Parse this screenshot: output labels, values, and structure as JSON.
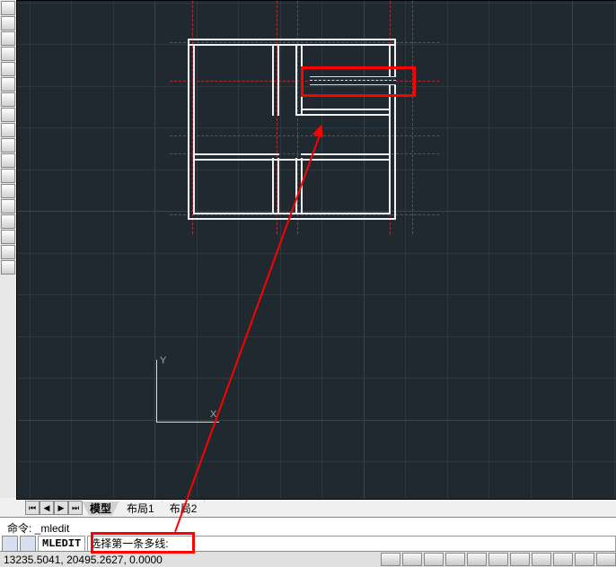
{
  "tabs": {
    "model": "模型",
    "layout1": "布局1",
    "layout2": "布局2"
  },
  "cmd": {
    "lastLine": "命令: _mledit",
    "prompt": "MLEDIT",
    "hint": "选择第一条多线:"
  },
  "ucs": {
    "x": "X",
    "y": "Y"
  },
  "status": {
    "coord": "13235.5041, 20495.2627, 0.0000"
  }
}
